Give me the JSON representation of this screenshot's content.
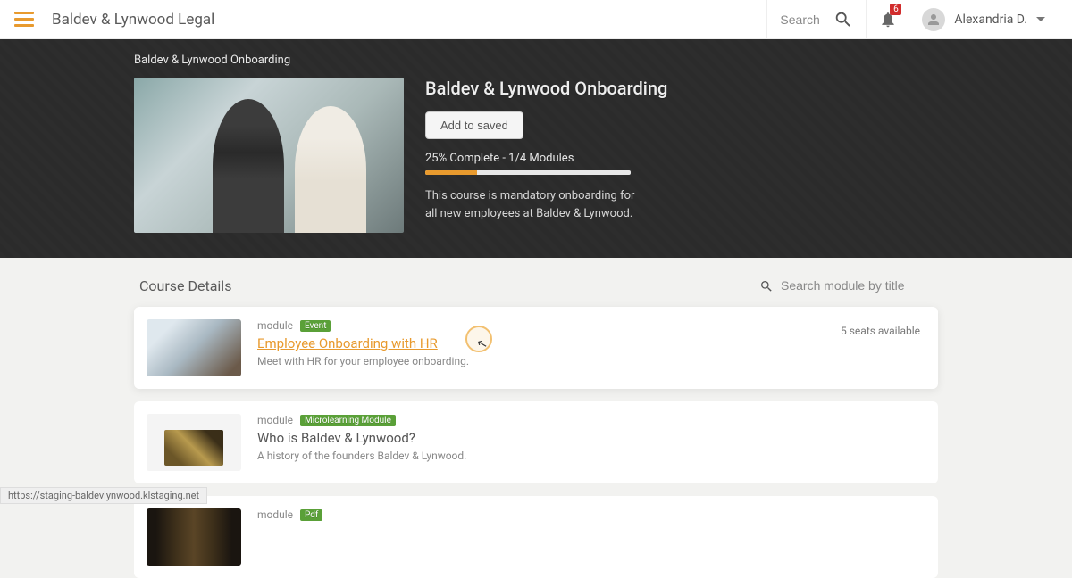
{
  "header": {
    "brand": "Baldev & Lynwood Legal",
    "search_placeholder": "Search",
    "notification_count": "6",
    "user_name": "Alexandria D."
  },
  "hero": {
    "breadcrumb": "Baldev & Lynwood Onboarding",
    "title": "Baldev & Lynwood Onboarding",
    "save_button": "Add to saved",
    "progress_text": "25% Complete - 1/4 Modules",
    "description": "This course is mandatory onboarding for all new employees at Baldev & Lynwood."
  },
  "details": {
    "heading": "Course Details",
    "search_placeholder": "Search module by title",
    "module_label": "module",
    "modules": [
      {
        "tag": "Event",
        "title": "Employee Onboarding with HR",
        "desc": "Meet with HR for your employee onboarding.",
        "seats": "5 seats available"
      },
      {
        "tag": "Microlearning Module",
        "title": "Who is Baldev & Lynwood?",
        "desc": "A history of the founders Baldev & Lynwood."
      },
      {
        "tag": "Pdf",
        "title": "",
        "desc": ""
      }
    ]
  },
  "status_url": "https://staging-baldevlynwood.klstaging.net"
}
